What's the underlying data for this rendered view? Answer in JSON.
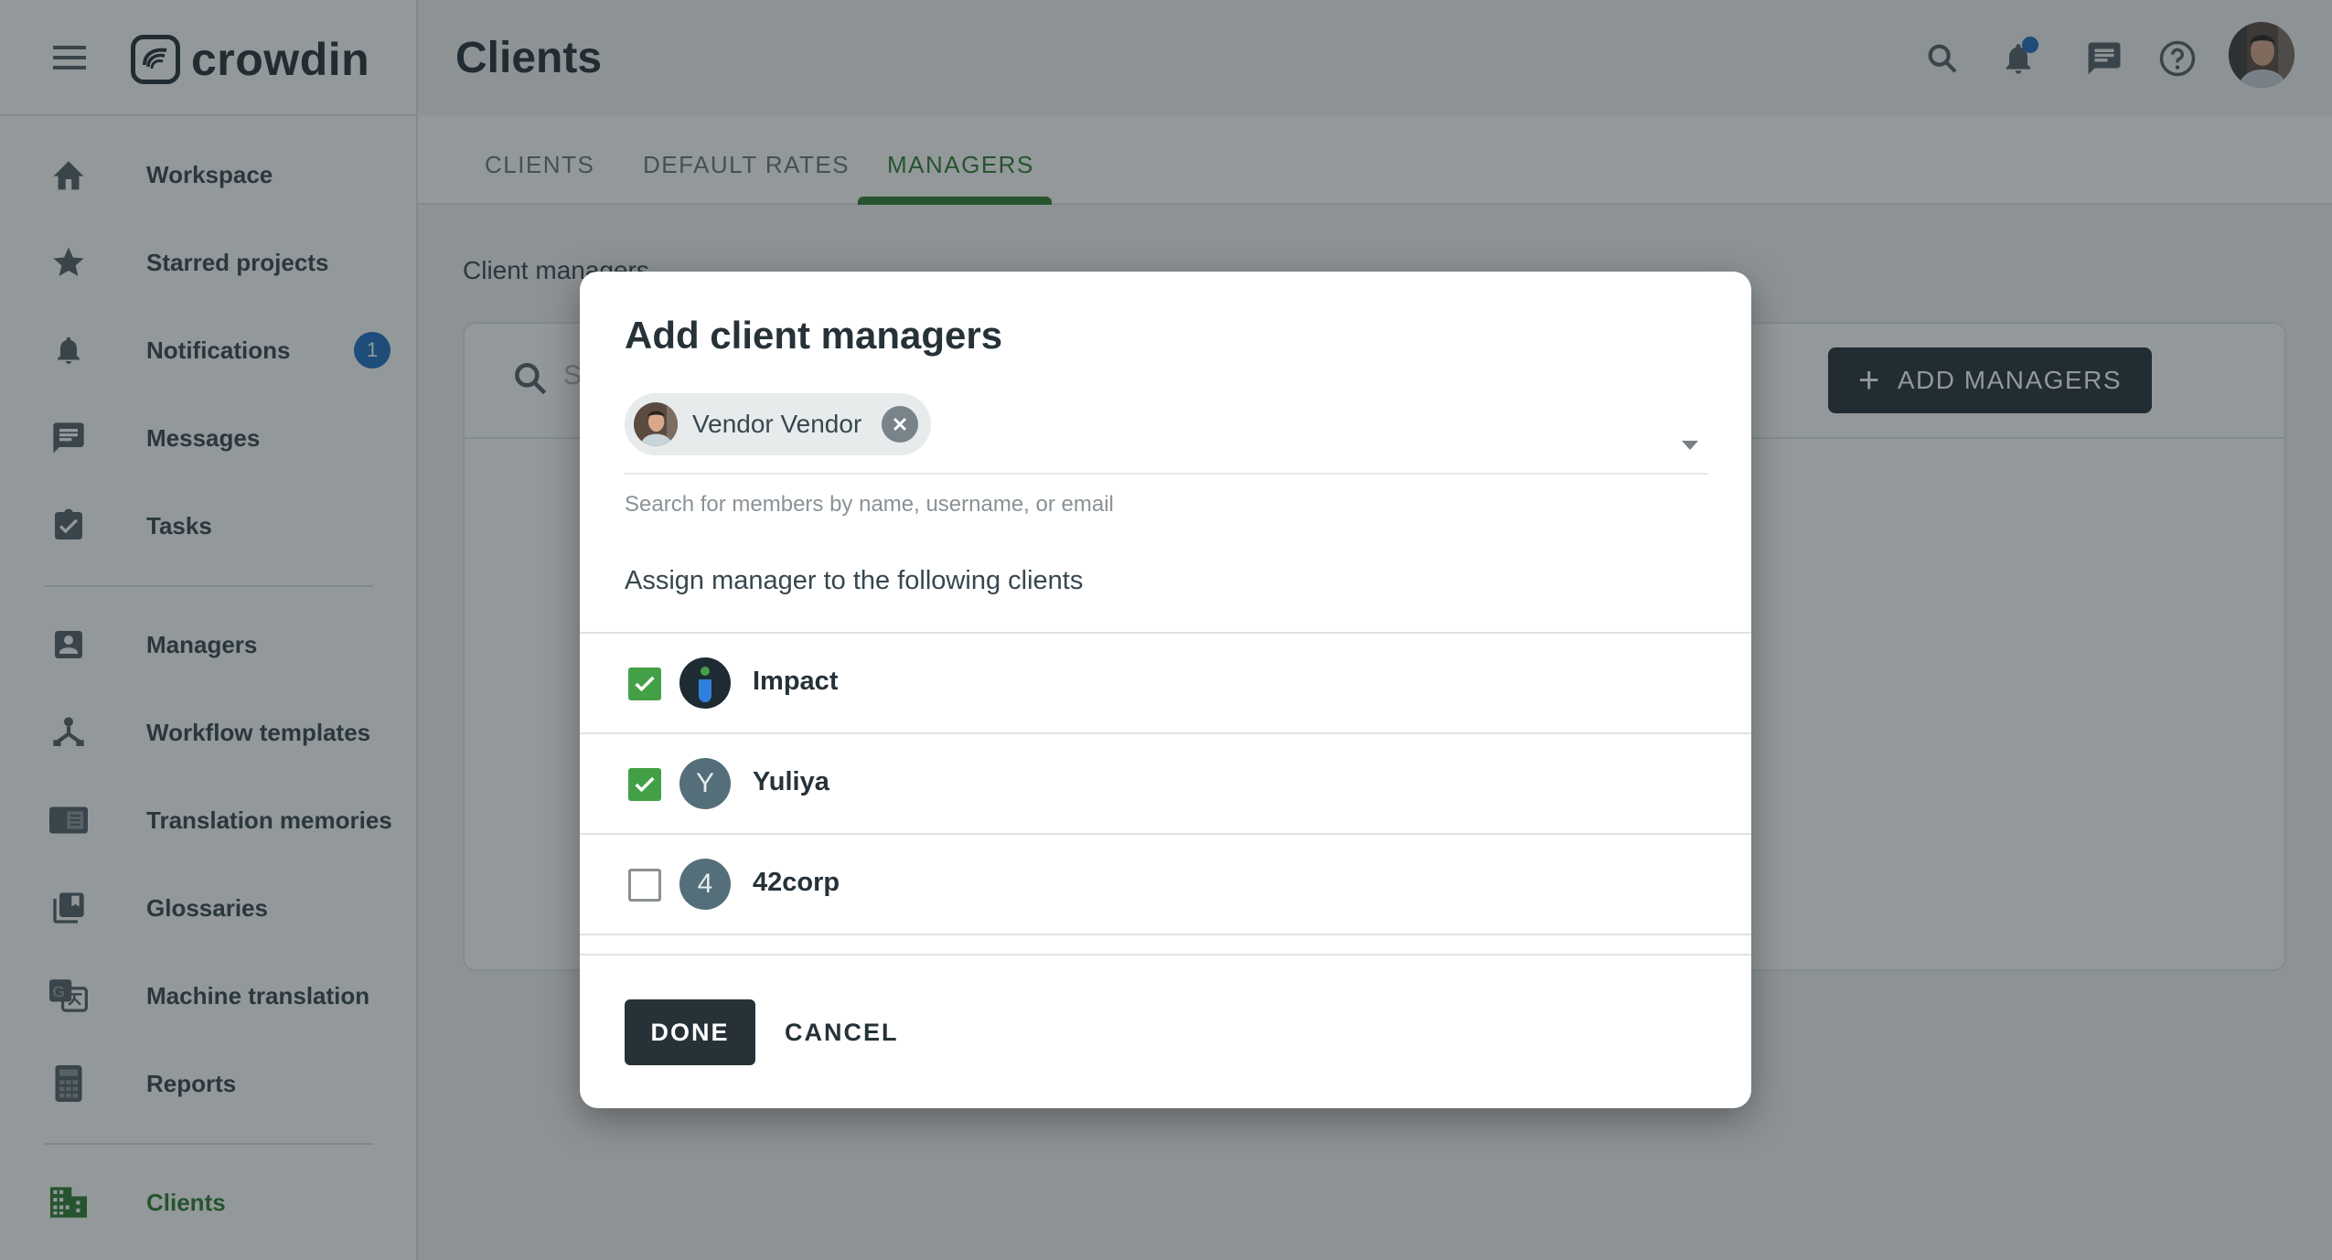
{
  "app": {
    "brand": "crowdin"
  },
  "sidebar": {
    "items": [
      {
        "label": "Workspace",
        "icon": "home-icon"
      },
      {
        "label": "Starred projects",
        "icon": "star-icon"
      },
      {
        "label": "Notifications",
        "icon": "bell-icon",
        "badge": "1"
      },
      {
        "label": "Messages",
        "icon": "message-icon"
      },
      {
        "label": "Tasks",
        "icon": "clipboard-check-icon"
      },
      {
        "label": "Managers",
        "icon": "account-box-icon"
      },
      {
        "label": "Workflow templates",
        "icon": "workflow-icon"
      },
      {
        "label": "Translation memories",
        "icon": "translation-memory-icon"
      },
      {
        "label": "Glossaries",
        "icon": "glossary-icon"
      },
      {
        "label": "Machine translation",
        "icon": "translate-icon"
      },
      {
        "label": "Reports",
        "icon": "calculator-icon"
      },
      {
        "label": "Clients",
        "icon": "building-icon",
        "active": true
      }
    ]
  },
  "header": {
    "title": "Clients",
    "notification_dot": true
  },
  "tabs": [
    {
      "label": "CLIENTS"
    },
    {
      "label": "DEFAULT RATES"
    },
    {
      "label": "MANAGERS",
      "active": true
    }
  ],
  "main": {
    "section_label": "Client managers",
    "search_placeholder": "Search",
    "add_button": "ADD MANAGERS"
  },
  "dialog": {
    "title": "Add client managers",
    "selected_member": "Vendor Vendor",
    "helper_text": "Search for members by name, username, or email",
    "assign_label": "Assign manager to the following clients",
    "clients": [
      {
        "name": "Impact",
        "checked": true,
        "avatar_letter": ""
      },
      {
        "name": "Yuliya",
        "checked": true,
        "avatar_letter": "Y"
      },
      {
        "name": "42corp",
        "checked": false,
        "avatar_letter": "4"
      }
    ],
    "done_label": "DONE",
    "cancel_label": "CANCEL"
  },
  "colors": {
    "accent": "#2e7d32",
    "primary_dark": "#263238",
    "badge_blue": "#1e6fbf",
    "checkbox_green": "#43a047"
  }
}
